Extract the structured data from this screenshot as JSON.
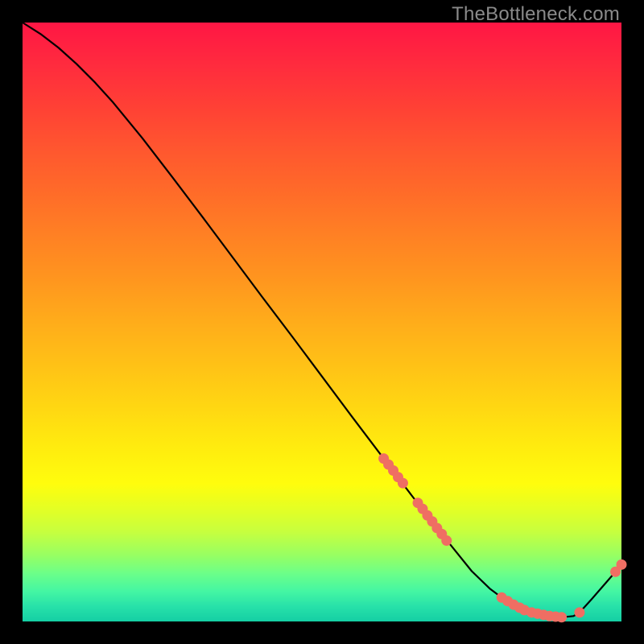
{
  "watermark": "TheBottleneck.com",
  "chart_data": {
    "type": "line",
    "title": "",
    "xlabel": "",
    "ylabel": "",
    "xlim": [
      0,
      100
    ],
    "ylim": [
      0,
      100
    ],
    "grid": false,
    "legend": false,
    "series": [
      {
        "name": "curve",
        "x": [
          0,
          3,
          6,
          9,
          12,
          15,
          20,
          25,
          30,
          35,
          40,
          45,
          50,
          55,
          60,
          65,
          70,
          75,
          78,
          80,
          82,
          84,
          86,
          88,
          90,
          92,
          93,
          95,
          97,
          99,
          100
        ],
        "y": [
          100,
          98.1,
          95.8,
          93.1,
          90.1,
          86.8,
          80.7,
          74.2,
          67.6,
          60.9,
          54.2,
          47.6,
          40.9,
          34.2,
          27.6,
          21.0,
          14.6,
          8.4,
          5.5,
          4.0,
          2.8,
          1.9,
          1.3,
          0.9,
          0.7,
          0.9,
          1.5,
          3.7,
          6.0,
          8.3,
          9.5
        ]
      }
    ],
    "markers": {
      "name": "highlighted-points",
      "x": [
        60.3,
        61.1,
        61.9,
        62.7,
        63.5,
        66.0,
        66.8,
        67.6,
        68.4,
        69.2,
        70.0,
        70.8,
        80.0,
        81.0,
        82.0,
        83.0,
        83.8,
        85.0,
        86.0,
        87.0,
        88.0,
        89.0,
        90.0,
        93.0,
        99.0,
        100.0
      ],
      "y": [
        27.2,
        26.2,
        25.2,
        24.1,
        23.1,
        19.8,
        18.8,
        17.7,
        16.7,
        15.6,
        14.6,
        13.5,
        4.0,
        3.4,
        2.8,
        2.3,
        1.9,
        1.5,
        1.3,
        1.1,
        0.9,
        0.8,
        0.7,
        1.5,
        8.3,
        9.5
      ]
    },
    "background_gradient_stops": [
      {
        "pos": 0.0,
        "color": "#ff1644"
      },
      {
        "pos": 0.25,
        "color": "#ff622b"
      },
      {
        "pos": 0.5,
        "color": "#ffae1a"
      },
      {
        "pos": 0.75,
        "color": "#fff90e"
      },
      {
        "pos": 0.9,
        "color": "#74ff82"
      },
      {
        "pos": 1.0,
        "color": "#15cfa4"
      }
    ]
  }
}
